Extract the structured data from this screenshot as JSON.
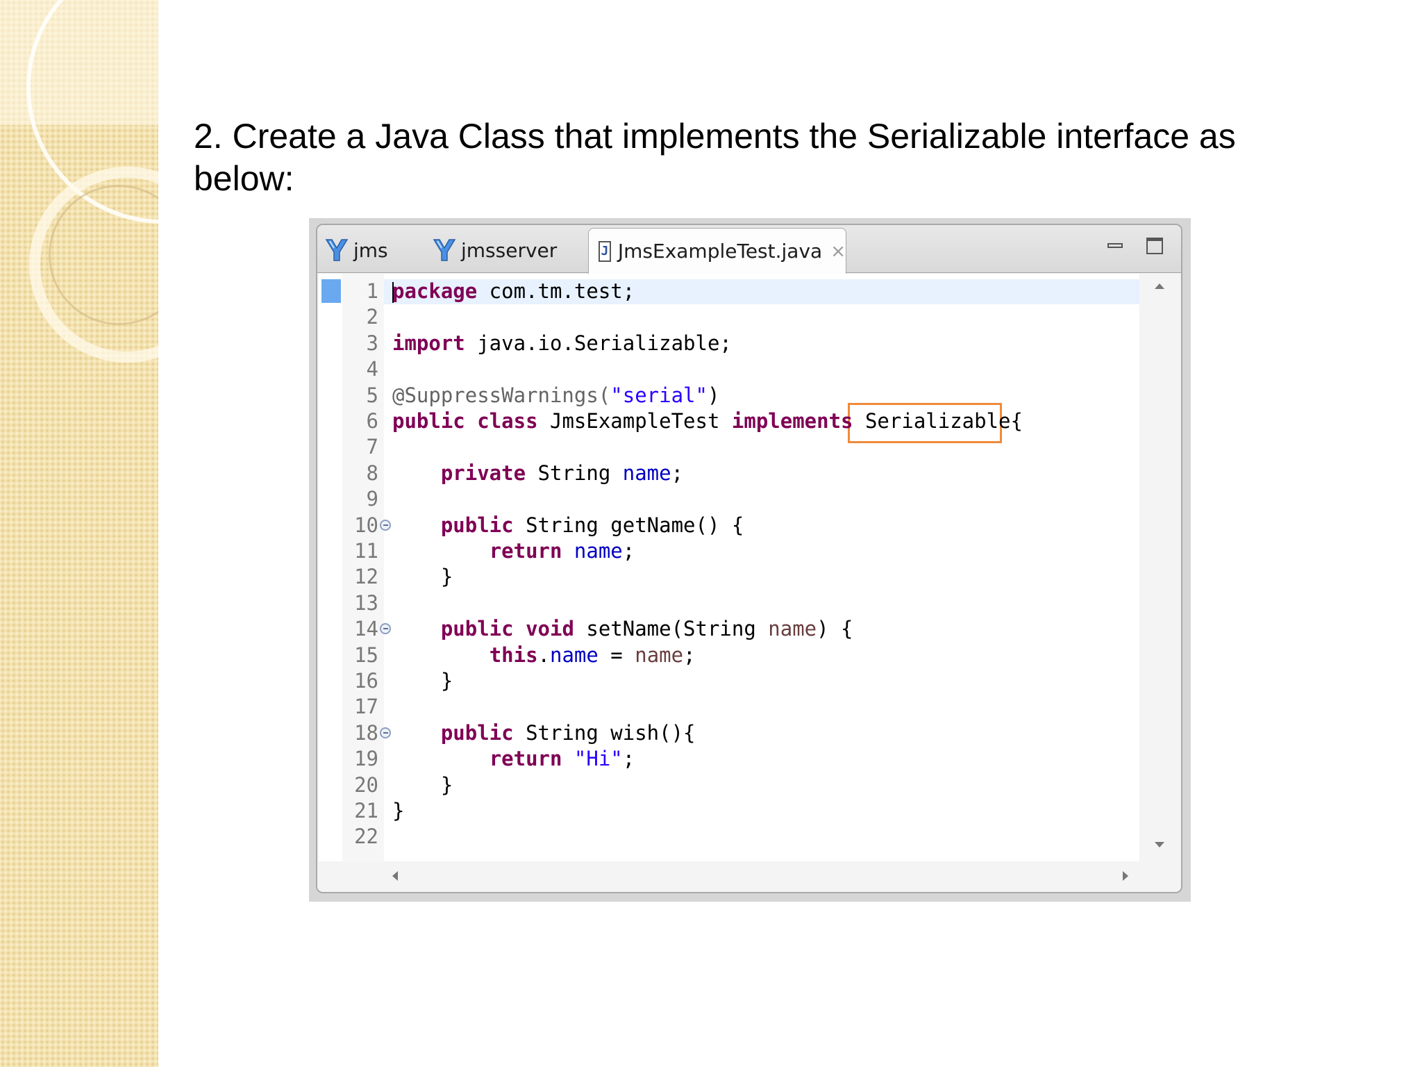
{
  "slide": {
    "instruction_line1": "2. Create a Java Class that implements the Serializable interface as",
    "instruction_line2": "below:"
  },
  "editor": {
    "tabs": [
      {
        "label": "jms",
        "icon": "java-project-icon"
      },
      {
        "label": "jmsserver",
        "icon": "java-project-icon"
      },
      {
        "label": "JmsExampleTest.java",
        "icon": "java-file-icon",
        "active": true
      }
    ],
    "java_icon_letter": "J",
    "close_glyph": "×",
    "highlighted_token": "Serializable",
    "colors": {
      "keyword": "#7f0055",
      "string": "#2a00ff",
      "field": "#0000c0",
      "annotation": "#646464",
      "highlight_box": "#ef8a3a",
      "current_line": "#e8f2fe",
      "bookmark": "#6aa9f0"
    },
    "lines": [
      {
        "n": "1",
        "segments": [
          {
            "t": "package",
            "c": "kw"
          },
          {
            "t": " com.tm.test;"
          }
        ]
      },
      {
        "n": "2",
        "segments": []
      },
      {
        "n": "3",
        "segments": [
          {
            "t": "import",
            "c": "kw"
          },
          {
            "t": " java.io.Serializable;"
          }
        ]
      },
      {
        "n": "4",
        "segments": []
      },
      {
        "n": "5",
        "segments": [
          {
            "t": "@SuppressWarnings(",
            "c": "ann"
          },
          {
            "t": "\"serial\"",
            "c": "str"
          },
          {
            "t": ")"
          }
        ]
      },
      {
        "n": "6",
        "segments": [
          {
            "t": "public",
            "c": "kw"
          },
          {
            "t": " "
          },
          {
            "t": "class",
            "c": "kw"
          },
          {
            "t": " JmsExampleTest "
          },
          {
            "t": "implements",
            "c": "kw"
          },
          {
            "t": " Serializable{"
          }
        ]
      },
      {
        "n": "7",
        "segments": []
      },
      {
        "n": "8",
        "segments": [
          {
            "t": "    "
          },
          {
            "t": "private",
            "c": "kw"
          },
          {
            "t": " String "
          },
          {
            "t": "name",
            "c": "fld"
          },
          {
            "t": ";"
          }
        ]
      },
      {
        "n": "9",
        "segments": []
      },
      {
        "n": "10",
        "fold": true,
        "segments": [
          {
            "t": "    "
          },
          {
            "t": "public",
            "c": "kw"
          },
          {
            "t": " String getName() {"
          }
        ]
      },
      {
        "n": "11",
        "segments": [
          {
            "t": "        "
          },
          {
            "t": "return",
            "c": "kw"
          },
          {
            "t": " "
          },
          {
            "t": "name",
            "c": "fld"
          },
          {
            "t": ";"
          }
        ]
      },
      {
        "n": "12",
        "segments": [
          {
            "t": "    }"
          }
        ]
      },
      {
        "n": "13",
        "segments": []
      },
      {
        "n": "14",
        "fold": true,
        "segments": [
          {
            "t": "    "
          },
          {
            "t": "public",
            "c": "kw"
          },
          {
            "t": " "
          },
          {
            "t": "void",
            "c": "kw"
          },
          {
            "t": " setName(String "
          },
          {
            "t": "name",
            "c": "prm"
          },
          {
            "t": ") {"
          }
        ]
      },
      {
        "n": "15",
        "segments": [
          {
            "t": "        "
          },
          {
            "t": "this",
            "c": "kw"
          },
          {
            "t": "."
          },
          {
            "t": "name",
            "c": "fld"
          },
          {
            "t": " = "
          },
          {
            "t": "name",
            "c": "prm"
          },
          {
            "t": ";"
          }
        ]
      },
      {
        "n": "16",
        "segments": [
          {
            "t": "    }"
          }
        ]
      },
      {
        "n": "17",
        "segments": []
      },
      {
        "n": "18",
        "fold": true,
        "segments": [
          {
            "t": "    "
          },
          {
            "t": "public",
            "c": "kw"
          },
          {
            "t": " String wish(){"
          }
        ]
      },
      {
        "n": "19",
        "segments": [
          {
            "t": "        "
          },
          {
            "t": "return",
            "c": "kw"
          },
          {
            "t": " "
          },
          {
            "t": "\"Hi\"",
            "c": "str"
          },
          {
            "t": ";"
          }
        ]
      },
      {
        "n": "20",
        "segments": [
          {
            "t": "    }"
          }
        ]
      },
      {
        "n": "21",
        "segments": [
          {
            "t": "}"
          }
        ]
      },
      {
        "n": "22",
        "segments": []
      }
    ]
  }
}
